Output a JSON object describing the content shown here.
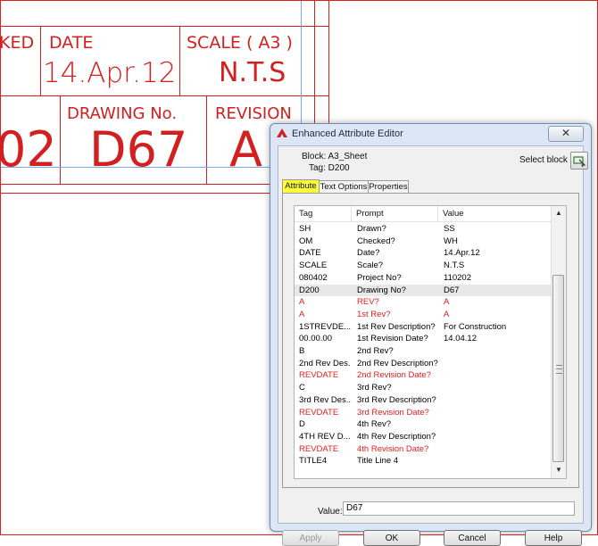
{
  "drawing": {
    "row1": {
      "checked_partial": "KED",
      "date_header": "DATE",
      "date_value": "14.Apr.12",
      "scale_header": "SCALE ( A3 )",
      "scale_value": "N.T.S"
    },
    "row2": {
      "project_partial": "02",
      "drawing_no_header": "DRAWING No.",
      "drawing_no_value": "D67",
      "revision_header": "REVISION",
      "revision_value": "A"
    }
  },
  "dialog": {
    "title": "Enhanced Attribute Editor",
    "close_label": "✕",
    "block_label": "Block: A3_Sheet",
    "tag_label": "Tag: D200",
    "select_block_label": "Select block",
    "tabs": [
      "Attribute",
      "Text Options",
      "Properties"
    ],
    "columns": [
      "Tag",
      "Prompt",
      "Value"
    ],
    "rows": [
      {
        "tag": "SH",
        "prompt": "Drawn?",
        "value": "SS"
      },
      {
        "tag": "OM",
        "prompt": "Checked?",
        "value": "WH"
      },
      {
        "tag": "DATE",
        "prompt": "Date?",
        "value": "14.Apr.12"
      },
      {
        "tag": "SCALE",
        "prompt": "Scale?",
        "value": "N.T.S"
      },
      {
        "tag": "080402",
        "prompt": "Project No?",
        "value": "110202"
      },
      {
        "tag": "D200",
        "prompt": "Drawing No?",
        "value": "D67"
      },
      {
        "tag": "A",
        "prompt": "REV?",
        "value": "A"
      },
      {
        "tag": "A",
        "prompt": "1st Rev?",
        "value": "A"
      },
      {
        "tag": "1STREVDE...",
        "prompt": "1st Rev Description?",
        "value": "For Construction"
      },
      {
        "tag": "00.00.00",
        "prompt": "1st Revision Date?",
        "value": "14.04.12"
      },
      {
        "tag": "B",
        "prompt": "2nd Rev?",
        "value": ""
      },
      {
        "tag": "2nd Rev Des...",
        "prompt": "2nd Rev Description?",
        "value": ""
      },
      {
        "tag": "REVDATE",
        "prompt": "2nd Revision Date?",
        "value": ""
      },
      {
        "tag": "C",
        "prompt": "3rd Rev?",
        "value": ""
      },
      {
        "tag": "3rd Rev Des...",
        "prompt": "3rd Rev Description?",
        "value": ""
      },
      {
        "tag": "REVDATE",
        "prompt": "3rd Revision Date?",
        "value": ""
      },
      {
        "tag": "D",
        "prompt": "4th Rev?",
        "value": ""
      },
      {
        "tag": "4TH REV D...",
        "prompt": "4th Rev Description?",
        "value": ""
      },
      {
        "tag": "REVDATE",
        "prompt": "4th Revision Date?",
        "value": ""
      },
      {
        "tag": "TITLE4",
        "prompt": "Title Line 4",
        "value": ""
      }
    ],
    "red_rows": [
      6,
      7,
      12,
      15,
      18
    ],
    "selected_row": 5,
    "value_label": "Value:",
    "value_input": "D67",
    "buttons": {
      "apply": "Apply",
      "ok": "OK",
      "cancel": "Cancel",
      "help": "Help"
    }
  },
  "colors": {
    "cad_red": "#d21f1f",
    "row_red": "#e02020",
    "active_tab": "#ffff3a"
  }
}
